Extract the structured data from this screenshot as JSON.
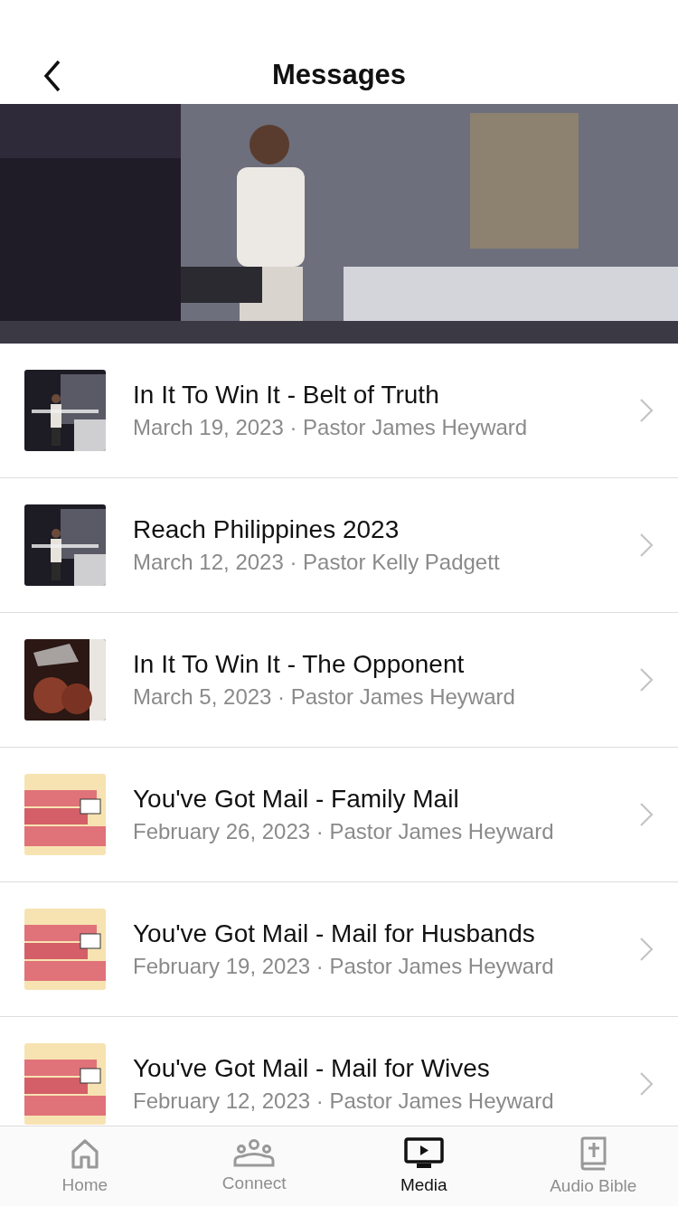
{
  "nav": {
    "title": "Messages"
  },
  "messages": [
    {
      "title": "In It To Win It - Belt of Truth",
      "subtitle": "March 19, 2023 · Pastor James Heyward"
    },
    {
      "title": "Reach Philippines 2023",
      "subtitle": "March 12, 2023 · Pastor Kelly Padgett"
    },
    {
      "title": "In It To Win It - The Opponent",
      "subtitle": "March 5, 2023 · Pastor James Heyward"
    },
    {
      "title": "You've Got Mail - Family Mail",
      "subtitle": "February 26, 2023 · Pastor James Heyward"
    },
    {
      "title": "You've Got Mail - Mail for Husbands",
      "subtitle": "February 19, 2023 · Pastor James Heyward"
    },
    {
      "title": "You've Got Mail - Mail for Wives",
      "subtitle": "February 12, 2023 · Pastor James Heyward"
    }
  ],
  "tabs": [
    {
      "label": "Home",
      "selected": false
    },
    {
      "label": "Connect",
      "selected": false
    },
    {
      "label": "Media",
      "selected": true
    },
    {
      "label": "Audio Bible",
      "selected": false
    }
  ]
}
